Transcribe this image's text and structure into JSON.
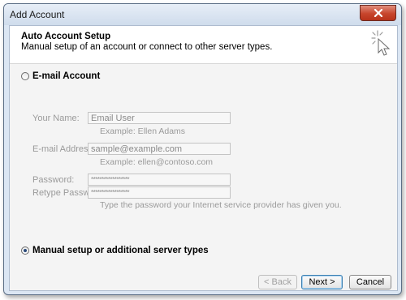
{
  "window": {
    "title": "Add Account",
    "close_icon": "close-icon"
  },
  "header": {
    "title": "Auto Account Setup",
    "subtitle": "Manual setup of an account or connect to other server types.",
    "icon": "sparkle-cursor-icon"
  },
  "options": {
    "email_account": {
      "label": "E-mail Account",
      "selected": false
    },
    "manual_setup": {
      "label": "Manual setup or additional server types",
      "selected": true
    }
  },
  "form": {
    "name_label": "Your Name:",
    "name_value": "Email User",
    "name_hint": "Example: Ellen Adams",
    "email_label": "E-mail Address:",
    "email_value": "sample@example.com",
    "email_hint": "Example: ellen@contoso.com",
    "password_label": "Password:",
    "password_value": "******************",
    "retype_label": "Retype Password:",
    "retype_value": "******************",
    "password_hint": "Type the password your Internet service provider has given you."
  },
  "buttons": {
    "back": "< Back",
    "next": "Next >",
    "cancel": "Cancel"
  }
}
